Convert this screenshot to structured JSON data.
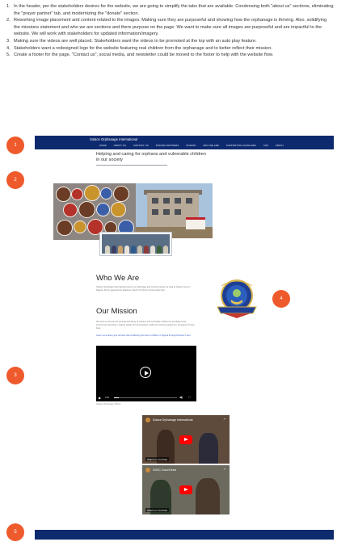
{
  "instructions": [
    {
      "number": "1.",
      "text": "In the header, per the stakeholders desires for the website, we are going to simplify the tabs that are available. Condensing both \"about us\" sections, eliminating the \"prayer partner\" tab, and modernizing the \"donate\" section."
    },
    {
      "number": "2.",
      "text": "Reworking image placement and content related to the images. Making sure they are purposeful and showing how the orphanage is thriving. Also, solidifying the missions statement and who we are sections and there purpose on the page. We want to make sure all images are purposeful and are impactful to the website. We will work with stakeholders for updated information/imagery."
    },
    {
      "number": "3.",
      "text": "Making sure the videos are well placed. Stakeholders want the videos to be promoted at the top with an auto play feature."
    },
    {
      "number": "4.",
      "text": "Stakeholders want a redesigned logo for the website featuring real children from the orphanage and to better reflect their mission."
    },
    {
      "number": "5.",
      "text": "Create a footer for the page. \"Contact us\", social media, and newsletter could be moved to the footer to help with the website flow."
    }
  ],
  "markers": [
    "1",
    "2",
    "3",
    "4",
    "5"
  ],
  "site": {
    "brand": "Solace Orphanage International",
    "nav": [
      "HOME",
      "ABOUT US",
      "CONTACT US",
      "PRAYER PARTNERS",
      "DONATE",
      "WHO WE ARE",
      "SUPPORTING CHURCHES",
      "CSS",
      "ABOUT"
    ],
    "tagline": "Helping and caring for orphans and vulnerable children in our society",
    "who_title": "Who We Are",
    "who_body": "Solace Orphanage International exists to a orphanage and ministry whose our goal at Solace home in Nigeria, SOI is supported by Rapturer Church of Christ in Otta nearby Abs.",
    "mission_title": "Our Mission",
    "mission_body": "We exist to promote the general well-being of orphans and vulnerable children by providing home environment and food, medical, quality formal education, skills and ministry guidance in all aspects of their lives.",
    "mission_link": "Learn more about your services that is affecting the lives of children in Nigeria through Rapturer's love.",
    "video": {
      "time": "0:00",
      "progress": 0.08,
      "caption": "Solace Orphanage Tribute"
    },
    "youtube": [
      {
        "title": "Solace Orphanage International",
        "watch": "Watch on YouTube"
      },
      {
        "title": "SSOC Good Deed",
        "watch": "Watch on YouTube"
      }
    ]
  },
  "colors": {
    "header": "#0e2a6e",
    "marker": "#ef5a2c",
    "link": "#3b64c7"
  }
}
